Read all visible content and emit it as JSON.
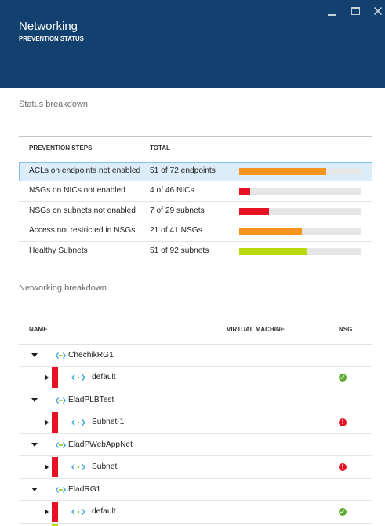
{
  "header": {
    "title": "Networking",
    "subtitle": "PREVENTION STATUS",
    "background_color": "#12406f",
    "controls": [
      "minimize-icon",
      "maximize-icon",
      "close-icon"
    ]
  },
  "status_breakdown": {
    "heading": "Status breakdown",
    "columns": {
      "step": "PREVENTION STEPS",
      "total": "TOTAL"
    },
    "track_color": "#e6e6e6",
    "rows": [
      {
        "step": "ACLs on endpoints not enabled",
        "total": "51 of 72 endpoints",
        "count": 51,
        "out_of": 72,
        "bar_color": "#f7941d",
        "selected": true
      },
      {
        "step": "NSGs on NICs not enabled",
        "total": "4 of 46 NICs",
        "count": 4,
        "out_of": 46,
        "bar_color": "#e81123",
        "selected": false
      },
      {
        "step": "NSGs on subnets not enabled",
        "total": "7 of 29 subnets",
        "count": 7,
        "out_of": 29,
        "bar_color": "#e81123",
        "selected": false
      },
      {
        "step": "Access not restricted in NSGs",
        "total": "21 of 41 NSGs",
        "count": 21,
        "out_of": 41,
        "bar_color": "#f7941d",
        "selected": false
      },
      {
        "step": "Healthy Subnets",
        "total": "51 of 92 subnets",
        "count": 51,
        "out_of": 92,
        "bar_color": "#bad80a",
        "selected": false
      }
    ]
  },
  "networking_breakdown": {
    "heading": "Networking breakdown",
    "columns": {
      "name": "NAME",
      "virtual_machine": "VIRTUAL MACHINE",
      "nsg": "NSG"
    },
    "rows": [
      {
        "name": "ChechikRG1",
        "level": 0,
        "expanded": true,
        "icon": "virtual-network-icon"
      },
      {
        "name": "default",
        "level": 1,
        "expanded": false,
        "icon": "subnet-icon",
        "severity_color": "#e81123",
        "nsg_icon": "check-circle-icon",
        "nsg_color": "#5ea92f"
      },
      {
        "name": "EladPLBTest",
        "level": 0,
        "expanded": true,
        "icon": "virtual-network-icon"
      },
      {
        "name": "Subnet-1",
        "level": 1,
        "expanded": false,
        "icon": "subnet-icon",
        "severity_color": "#e81123",
        "nsg_icon": "error-circle-icon",
        "nsg_color": "#e81123"
      },
      {
        "name": "EladPWebAppNet",
        "level": 0,
        "expanded": true,
        "icon": "virtual-network-icon"
      },
      {
        "name": "Subnet",
        "level": 1,
        "expanded": false,
        "icon": "subnet-icon",
        "severity_color": "#e81123",
        "nsg_icon": "error-circle-icon",
        "nsg_color": "#e81123"
      },
      {
        "name": "EladRG1",
        "level": 0,
        "expanded": true,
        "icon": "virtual-network-icon"
      },
      {
        "name": "default",
        "level": 1,
        "expanded": false,
        "icon": "subnet-icon",
        "severity_color": "#e81123",
        "nsg_icon": "check-circle-icon",
        "nsg_color": "#5ea92f"
      },
      {
        "level": 1,
        "severity_color": "#bad80a"
      }
    ]
  }
}
